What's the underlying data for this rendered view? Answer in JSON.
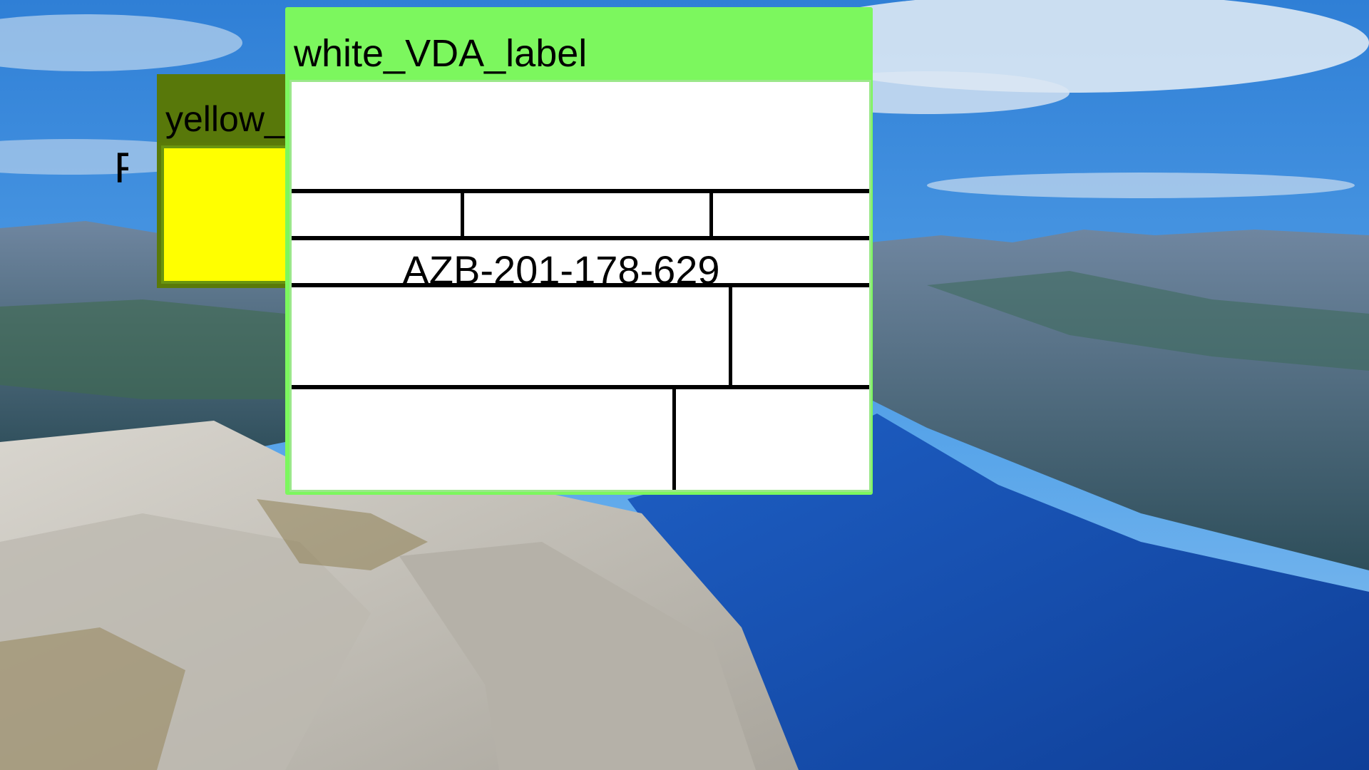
{
  "wallpaper": {
    "description_icon": "fjord-landscape-wallpaper",
    "sky_color": "#3c8ad6",
    "water_color": "#1d55b6",
    "rock_color": "#c9c6bf"
  },
  "windows": {
    "yellow": {
      "title": "yellow_",
      "glyph": "F",
      "titlebar_color": "#58780a",
      "content_color": "#ffff00"
    },
    "white_label": {
      "title": "white_VDA_label",
      "frame_color": "#7cf75e",
      "label_number": "AZB-201-178-629"
    }
  }
}
